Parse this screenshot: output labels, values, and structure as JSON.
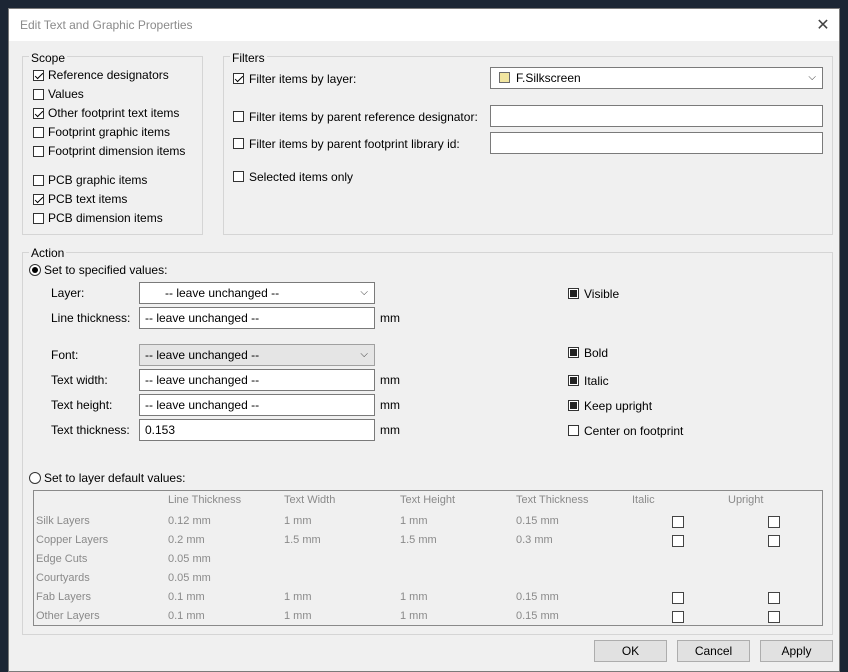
{
  "title": "Edit Text and Graphic Properties",
  "scope": {
    "label": "Scope",
    "items": [
      {
        "label": "Reference designators",
        "checked": true
      },
      {
        "label": "Values",
        "checked": false
      },
      {
        "label": "Other footprint text items",
        "checked": true
      },
      {
        "label": "Footprint graphic items",
        "checked": false
      },
      {
        "label": "Footprint dimension items",
        "checked": false
      },
      {
        "label": "PCB graphic items",
        "checked": false
      },
      {
        "label": "PCB text items",
        "checked": true
      },
      {
        "label": "PCB dimension items",
        "checked": false
      }
    ]
  },
  "filters": {
    "label": "Filters",
    "by_layer": {
      "label": "Filter items by layer:",
      "checked": true,
      "value": "F.Silkscreen",
      "swatch_color": "#f2e6a0"
    },
    "by_ref": {
      "label": "Filter items by parent reference designator:",
      "checked": false,
      "value": ""
    },
    "by_lib": {
      "label": "Filter items by parent footprint library id:",
      "checked": false,
      "value": ""
    },
    "selected_only": {
      "label": "Selected items only",
      "checked": false
    }
  },
  "action": {
    "label": "Action",
    "set_specified": "Set to specified values:",
    "set_default": "Set to layer default values:",
    "layer_label": "Layer:",
    "layer_value": "-- leave unchanged --",
    "line_thickness_label": "Line thickness:",
    "line_thickness_value": "-- leave unchanged --",
    "font_label": "Font:",
    "font_value": "-- leave unchanged --",
    "text_width_label": "Text width:",
    "text_width_value": "-- leave unchanged --",
    "text_height_label": "Text height:",
    "text_height_value": "-- leave unchanged --",
    "text_thickness_label": "Text thickness:",
    "text_thickness_value": "0.153",
    "unit": "mm",
    "visible": "Visible",
    "bold": "Bold",
    "italic": "Italic",
    "keep_upright": "Keep upright",
    "center_on_footprint": "Center on footprint"
  },
  "defaults_table": {
    "headers": [
      "Line Thickness",
      "Text Width",
      "Text Height",
      "Text Thickness",
      "Italic",
      "Upright"
    ],
    "rows": [
      {
        "name": "Silk Layers",
        "line": "0.12 mm",
        "width": "1 mm",
        "height": "1 mm",
        "thick": "0.15 mm",
        "checks": true
      },
      {
        "name": "Copper Layers",
        "line": "0.2 mm",
        "width": "1.5 mm",
        "height": "1.5 mm",
        "thick": "0.3 mm",
        "checks": true
      },
      {
        "name": "Edge Cuts",
        "line": "0.05 mm",
        "width": "",
        "height": "",
        "thick": "",
        "checks": false
      },
      {
        "name": "Courtyards",
        "line": "0.05 mm",
        "width": "",
        "height": "",
        "thick": "",
        "checks": false
      },
      {
        "name": "Fab Layers",
        "line": "0.1 mm",
        "width": "1 mm",
        "height": "1 mm",
        "thick": "0.15 mm",
        "checks": true
      },
      {
        "name": "Other Layers",
        "line": "0.1 mm",
        "width": "1 mm",
        "height": "1 mm",
        "thick": "0.15 mm",
        "checks": true
      }
    ]
  },
  "buttons": {
    "ok": "OK",
    "cancel": "Cancel",
    "apply": "Apply"
  }
}
